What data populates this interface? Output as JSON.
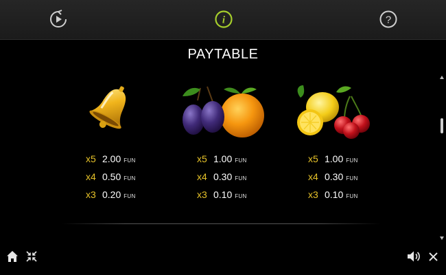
{
  "header": {
    "buttons": [
      {
        "name": "replay-icon"
      },
      {
        "name": "info-icon"
      },
      {
        "name": "help-icon"
      }
    ]
  },
  "title": "PAYTABLE",
  "colors": {
    "multiplier": "#e6c229",
    "active_icon": "#a6ce2c"
  },
  "symbols": [
    {
      "icons": [
        "bell-icon"
      ],
      "payouts": [
        {
          "mult": "x5",
          "amount": "2.00",
          "currency": "FUN"
        },
        {
          "mult": "x4",
          "amount": "0.50",
          "currency": "FUN"
        },
        {
          "mult": "x3",
          "amount": "0.20",
          "currency": "FUN"
        }
      ]
    },
    {
      "icons": [
        "plum-icon",
        "orange-icon"
      ],
      "payouts": [
        {
          "mult": "x5",
          "amount": "1.00",
          "currency": "FUN"
        },
        {
          "mult": "x4",
          "amount": "0.30",
          "currency": "FUN"
        },
        {
          "mult": "x3",
          "amount": "0.10",
          "currency": "FUN"
        }
      ]
    },
    {
      "icons": [
        "lemon-icon",
        "cherry-icon"
      ],
      "payouts": [
        {
          "mult": "x5",
          "amount": "1.00",
          "currency": "FUN"
        },
        {
          "mult": "x4",
          "amount": "0.30",
          "currency": "FUN"
        },
        {
          "mult": "x3",
          "amount": "0.10",
          "currency": "FUN"
        }
      ]
    }
  ],
  "footer": {
    "left": [
      "home-icon",
      "collapse-icon"
    ],
    "right": [
      "sound-icon",
      "close-icon"
    ]
  }
}
